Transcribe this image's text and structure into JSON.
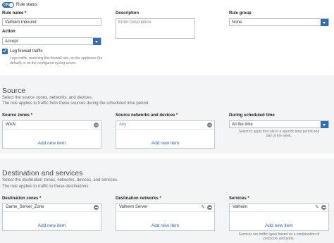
{
  "rule_status": {
    "toggle_text": "ON",
    "label": "Rule status",
    "on": true
  },
  "rule_name": {
    "label": "Rule name *",
    "value": "Valheim Inbound"
  },
  "description": {
    "label": "Description",
    "placeholder": "Enter Description"
  },
  "rule_group": {
    "label": "Rule group",
    "value": "None"
  },
  "action": {
    "label": "Action",
    "value": "Accept"
  },
  "log_traffic": {
    "label": "Log firewall traffic",
    "help_line1": "Logs traffic, matching this firewall rule, on the appliance (by",
    "help_line2": "default) or on the configured syslog server.",
    "checked": true
  },
  "source": {
    "title": "Source",
    "desc_line1": "Select the source zones, networks, and devices.",
    "desc_line2": "The rule applies to traffic from these sources during the scheduled time period.",
    "zones": {
      "label": "Source zones *",
      "item": "WAN",
      "add": "Add new item"
    },
    "networks": {
      "label": "Source networks and devices *",
      "item": "Any",
      "add": "Add new item"
    },
    "schedule": {
      "label": "During scheduled time",
      "value": "All the time",
      "help_line1": "Select to apply the rule to a specific time period and",
      "help_line2": "day of the week."
    }
  },
  "destination": {
    "title": "Destination and services",
    "desc_line1": "Select the destination zones, networks, devices, and services.",
    "desc_line2": "The rule applies to traffic to these destinations.",
    "zones": {
      "label": "Destination zones *",
      "item": "Game_Server_Zone",
      "add": "Add new item"
    },
    "networks": {
      "label": "Destination networks *",
      "item": "Valheim Server",
      "add": "Add new item"
    },
    "services": {
      "label": "Services *",
      "item": "Valheim",
      "add": "Add new item",
      "help_line1": "Services are traffic types based on a combination of",
      "help_line2": "protocols and ports."
    }
  },
  "colors": {
    "accent": "#2f6db5",
    "link": "#2a63ad",
    "section_bg": "#f3f4f6",
    "border": "#b9c0c8"
  },
  "icons": [
    "toggle-switch-icon",
    "caret-down-icon",
    "checkbox-checked-icon",
    "remove-icon",
    "pencil-icon"
  ]
}
